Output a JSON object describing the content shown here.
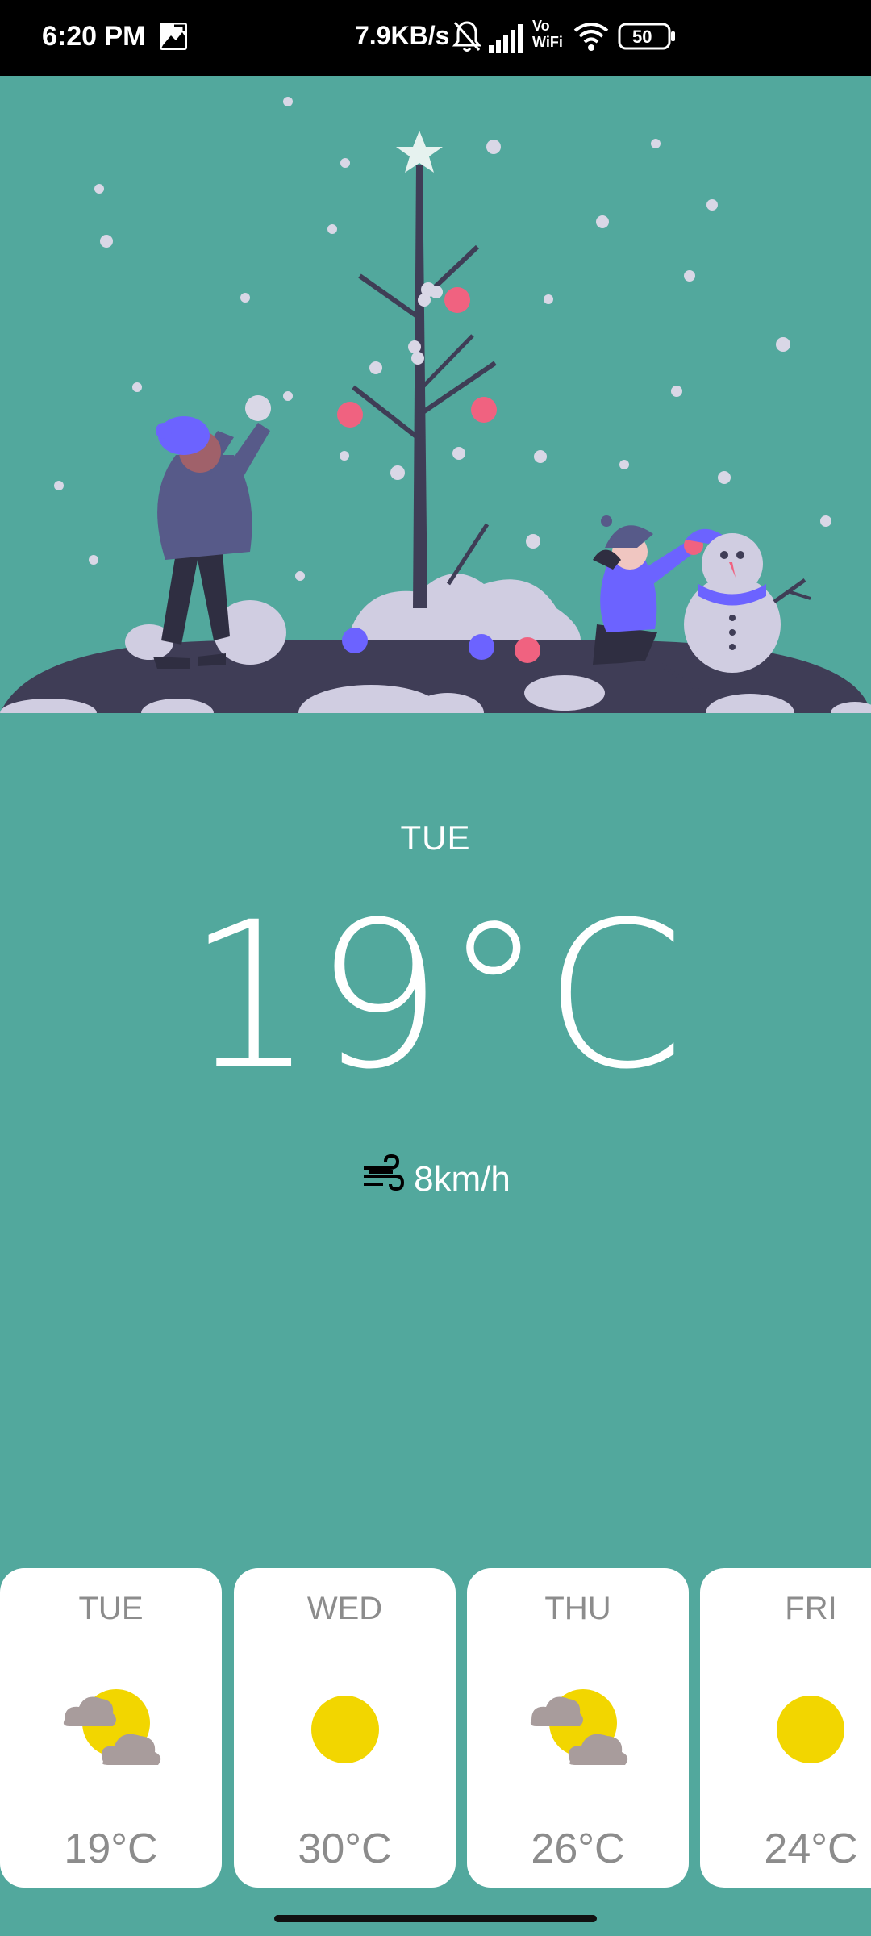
{
  "status_bar": {
    "time": "6:20 PM",
    "data_speed": "7.9KB/s",
    "battery": "50",
    "vo_wifi_top": "Vo",
    "vo_wifi_bottom": "WiFi"
  },
  "current": {
    "day": "TUE",
    "temperature": "19°C",
    "wind": "8km/h"
  },
  "forecast": [
    {
      "day": "TUE",
      "temp": "19°C",
      "icon": "partly-cloudy-icon"
    },
    {
      "day": "WED",
      "temp": "30°C",
      "icon": "sun-icon"
    },
    {
      "day": "THU",
      "temp": "26°C",
      "icon": "partly-cloudy-icon"
    },
    {
      "day": "FRI",
      "temp": "24°C",
      "icon": "sun-icon"
    }
  ],
  "colors": {
    "background": "#52a89d",
    "sun": "#f2d600",
    "cloud": "#a89c9c",
    "card_text": "#8c8c8c"
  }
}
